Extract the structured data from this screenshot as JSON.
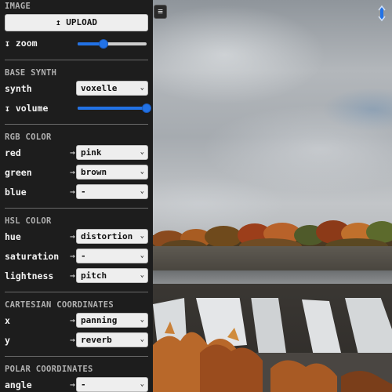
{
  "panel_toggle_icon": "hamburger-icon",
  "image": {
    "section_title": "IMAGE",
    "upload_label": "↥ UPLOAD",
    "zoom_label": "↧ zoom",
    "zoom_level": 0.38
  },
  "base_synth": {
    "section_title": "BASE SYNTH",
    "synth_label": "synth",
    "synth_value": "voxelle",
    "volume_label": "↧ volume",
    "volume_level": 1.0
  },
  "rgb_color": {
    "section_title": "RGB COLOR",
    "rows": [
      {
        "label": "red",
        "value": "pink"
      },
      {
        "label": "green",
        "value": "brown"
      },
      {
        "label": "blue",
        "value": "-"
      }
    ]
  },
  "hsl_color": {
    "section_title": "HSL COLOR",
    "rows": [
      {
        "label": "hue",
        "value": "distortion"
      },
      {
        "label": "saturation",
        "value": "-"
      },
      {
        "label": "lightness",
        "value": "pitch"
      }
    ]
  },
  "cartesian": {
    "section_title": "CARTESIAN COORDINATES",
    "rows": [
      {
        "label": "x",
        "value": "panning"
      },
      {
        "label": "y",
        "value": "reverb"
      }
    ]
  },
  "polar": {
    "section_title": "POLAR COORDINATES",
    "rows": [
      {
        "label": "angle",
        "value": "-"
      }
    ]
  },
  "arrow_glyph": "→",
  "colors": {
    "accent": "#2272e6",
    "panel_bg": "#1d1d1d",
    "control_bg": "#eeeeee"
  }
}
